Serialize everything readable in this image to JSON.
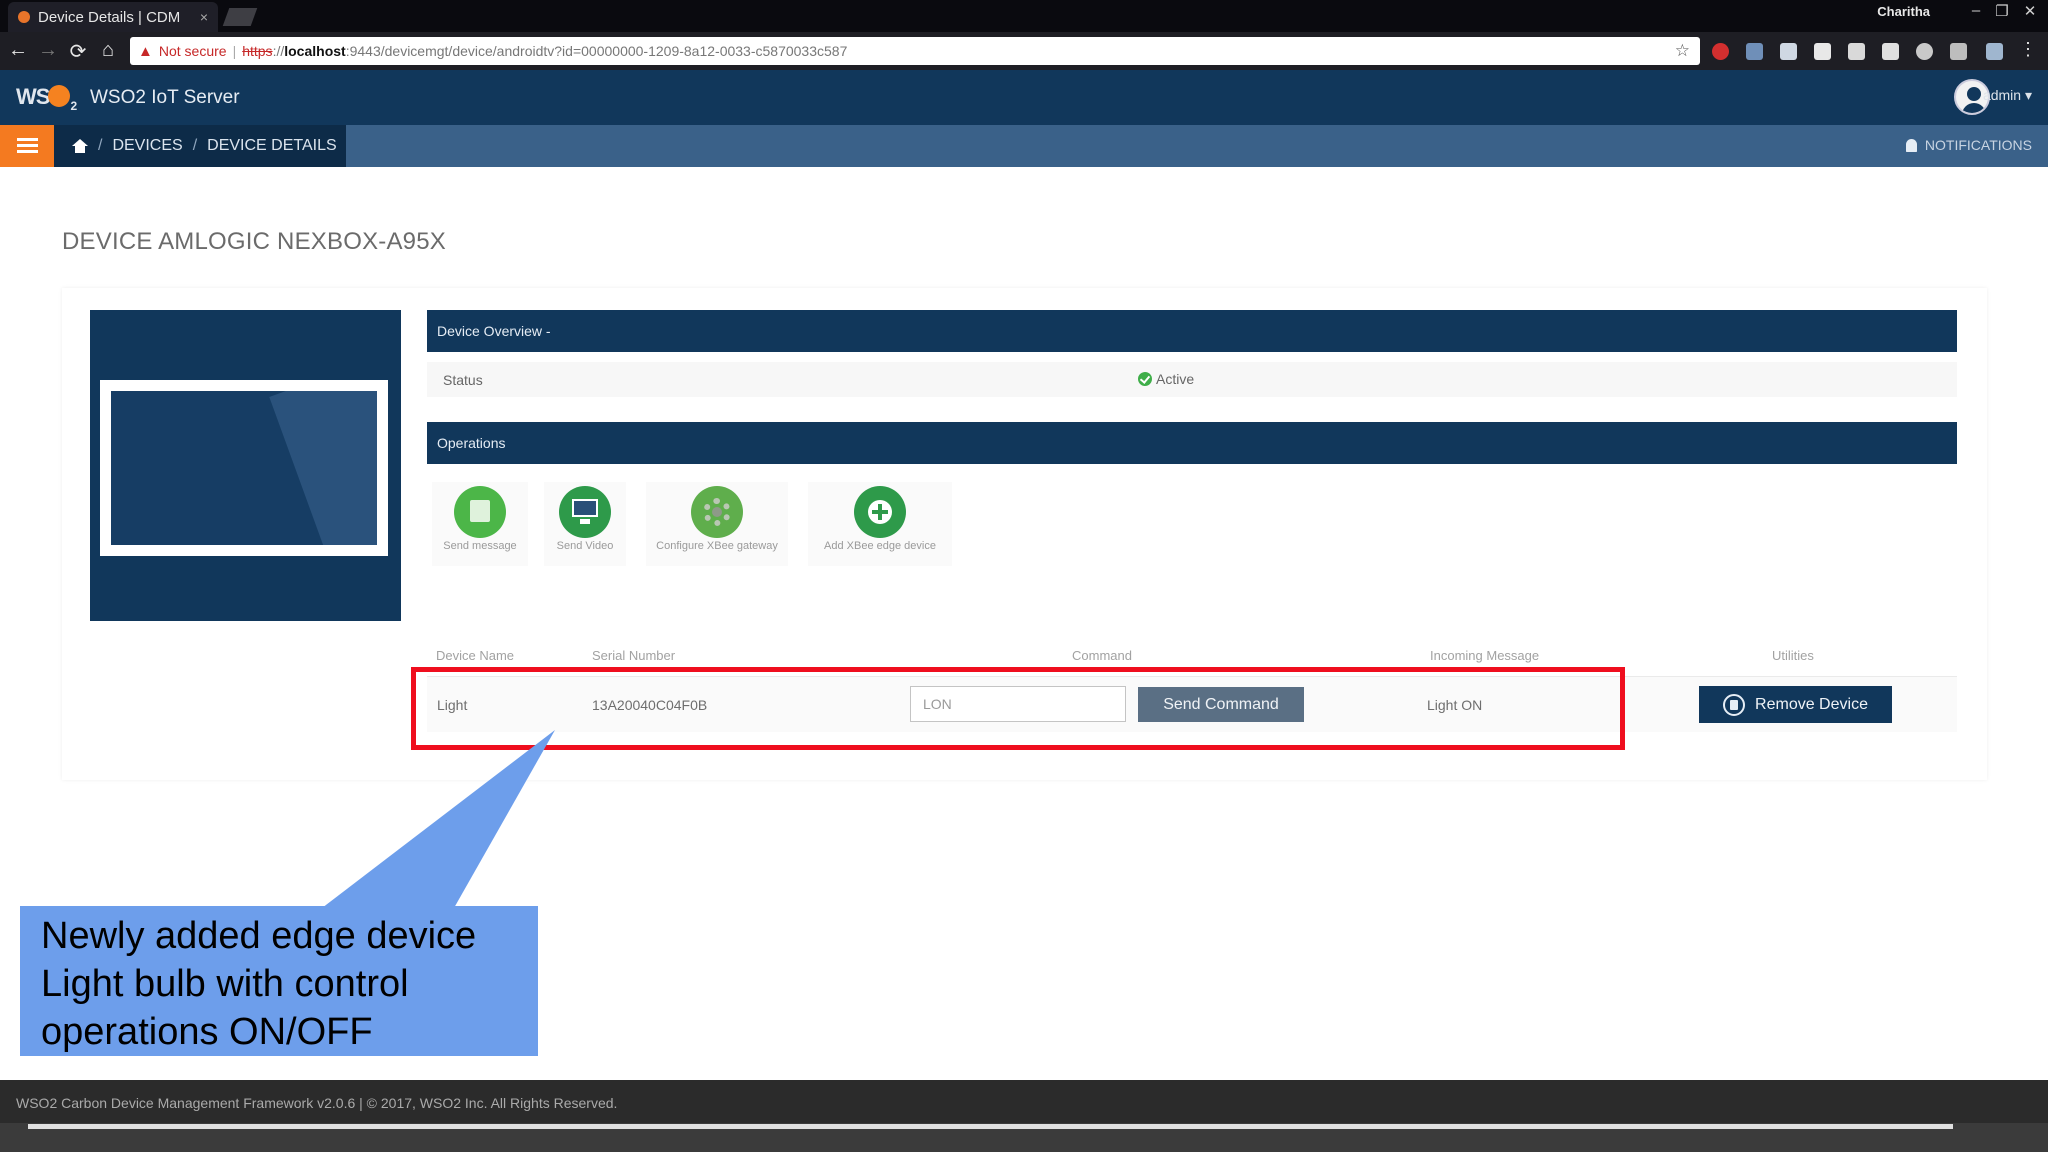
{
  "browser": {
    "tab_title": "Device Details | CDM",
    "tab_close": "×",
    "profile_name": "Charitha",
    "window_controls": [
      "–",
      "❐",
      "✕"
    ],
    "nav_icons": [
      "back-icon",
      "forward-icon",
      "reload-icon",
      "home-icon"
    ],
    "security_label": "Not secure",
    "url_scheme": "https",
    "url_sep": "://",
    "url_host": "localhost",
    "url_path": ":9443/devicemgt/device/androidtv?id=00000000-1209-8a12-0033-c5870033c587"
  },
  "app": {
    "logo_text": "WS",
    "logo_sub": "2",
    "name": "WSO2 IoT Server",
    "user_label": "admin ▾"
  },
  "breadcrumb": {
    "items": [
      "DEVICES",
      "DEVICE DETAILS"
    ],
    "separator": "/",
    "notifications_label": "NOTIFICATIONS"
  },
  "page": {
    "title": "DEVICE AMLOGIC NEXBOX-A95X"
  },
  "overview": {
    "header": "Device Overview -",
    "status_label": "Status",
    "status_value": "Active"
  },
  "operations": {
    "header": "Operations",
    "items": [
      {
        "label": "Send message",
        "icon": "message-icon",
        "color": "#4cb648"
      },
      {
        "label": "Send Video",
        "icon": "monitor-icon",
        "color": "#2e9a4a"
      },
      {
        "label": "Configure XBee gateway",
        "icon": "gear-icon",
        "color": "#5fae4c"
      },
      {
        "label": "Add XBee edge device",
        "icon": "plus-icon",
        "color": "#2e9a4a"
      }
    ]
  },
  "edge_table": {
    "columns": [
      "Device Name",
      "Serial Number",
      "Command",
      "Incoming Message",
      "Utilities"
    ],
    "row": {
      "device_name": "Light",
      "serial_number": "13A20040C04F0B",
      "command_value": "LON",
      "send_label": "Send Command",
      "incoming_message": "Light ON",
      "remove_label": "Remove Device"
    }
  },
  "annotation": {
    "lines": [
      "Newly added edge device",
      "Light bulb with control",
      "operations ON/OFF"
    ],
    "highlight_color": "#ef0e1e",
    "callout_color": "#6d9eeb"
  },
  "footer": {
    "text": "WSO2 Carbon Device Management Framework v2.0.6 | © 2017, WSO2 Inc. All Rights Reserved."
  }
}
